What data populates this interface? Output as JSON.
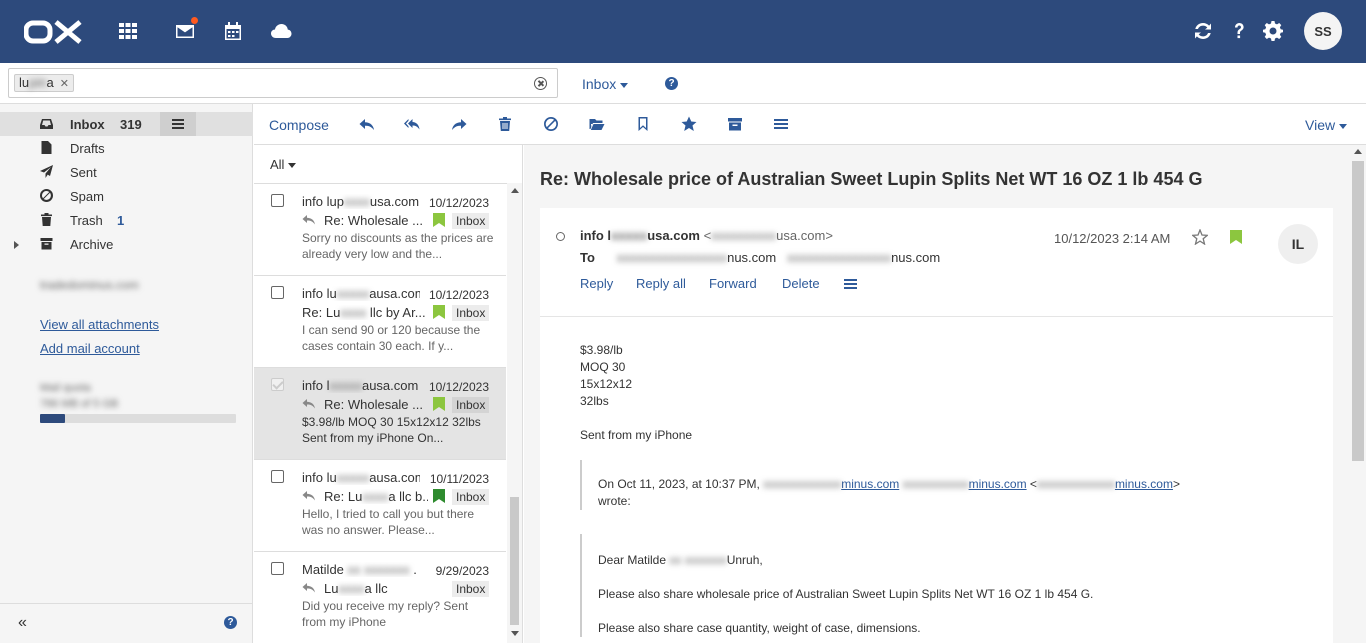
{
  "app": {
    "logo_text": "OX",
    "user_initials": "SS"
  },
  "search": {
    "token_visible": "lu",
    "token_blurred": "pin",
    "token_tail": "a",
    "folder_select": "Inbox"
  },
  "sidebar": {
    "folders": [
      {
        "label": "Inbox",
        "count": "319"
      },
      {
        "label": "Drafts",
        "count": ""
      },
      {
        "label": "Sent",
        "count": ""
      },
      {
        "label": "Spam",
        "count": ""
      },
      {
        "label": "Trash",
        "count": "1"
      },
      {
        "label": "Archive",
        "count": ""
      }
    ],
    "account_name": "tradedominus.com",
    "view_attachments": "View all attachments",
    "add_account": "Add mail account",
    "quota_label": "Mail quota",
    "quota_value": "786 MB of 5 GB",
    "quota_fraction": 0.13
  },
  "toolbar": {
    "compose": "Compose",
    "view": "View"
  },
  "list": {
    "filter": "All",
    "items": [
      {
        "from_a": "info lup",
        "from_b": "xxxx",
        "from_c": "usa.com",
        "date": "10/12/2023",
        "subject": "Re: Wholesale ...",
        "folder": "Inbox",
        "preview": "Sorry no discounts as the prices are already very low and the..."
      },
      {
        "from_a": "info lu",
        "from_b": "xxxxx",
        "from_c": "ausa.com",
        "date": "10/12/2023",
        "subject": "Re: Lu",
        "subject_b": "xxxx",
        "subject_c": " llc by Ar...",
        "folder": "Inbox",
        "preview": "I can send 90 or 120 because the cases contain 30 each. If y..."
      },
      {
        "from_a": "info l",
        "from_b": "xxxxx",
        "from_c": "ausa.com",
        "date": "10/12/2023",
        "subject": "Re: Wholesale ...",
        "folder": "Inbox",
        "preview": "$3.98/lb MOQ 30 15x12x12 32lbs Sent from my iPhone On..."
      },
      {
        "from_a": "info lu",
        "from_b": "xxxxx",
        "from_c": "ausa.com",
        "date": "10/11/2023",
        "subject": "Re: Lu",
        "subject_b": "xxxx",
        "subject_c": "a llc b...",
        "folder": "Inbox",
        "preview": "Hello, I tried to call you but there was no answer. Please..."
      },
      {
        "from_a": "Matilde ",
        "from_b": "xx xxxxxxx",
        "from_c": " .",
        "date": "9/29/2023",
        "subject": "Lu",
        "subject_b": "xxxx",
        "subject_c": "a llc",
        "folder": "Inbox",
        "preview": "Did you receive my reply? Sent from my iPhone"
      }
    ]
  },
  "detail": {
    "subject": "Re: Wholesale price of Australian Sweet Lupin Splits Net WT 16 OZ 1 lb 454 G",
    "from_a": "info l",
    "from_b": "xxxxx",
    "from_c": "usa.com",
    "from_addr_b": "xxxxxxxxxx",
    "from_addr_c": "usa.com",
    "to_label": "To",
    "to_b1": "xxxxxxxxxxxxxxxxx",
    "to_c1": "nus.com",
    "to_b2": "xxxxxxxxxxxxxxxx",
    "to_c2": "nus.com",
    "date": "10/12/2023 2:14 AM",
    "sender_initials": "IL",
    "actions": {
      "reply": "Reply",
      "reply_all": "Reply all",
      "forward": "Forward",
      "delete": "Delete"
    },
    "body_lines": [
      "$3.98/lb",
      "MOQ 30",
      "15x12x12",
      "32lbs"
    ],
    "signature": "Sent from my iPhone",
    "quote_intro": "On Oct 11, 2023, at 10:37 PM,",
    "quote_link_c": "minus.com",
    "quote_wrote": "wrote:",
    "quote_greeting_a": "Dear Matilde ",
    "quote_greeting_b": "xx xxxxxxx",
    "quote_greeting_c": "Unruh,",
    "quote_p1": "Please also share wholesale price of Australian Sweet Lupin Splits Net WT 16 OZ 1 lb 454 G.",
    "quote_p2": "Please also share case quantity, weight of case, dimensions."
  },
  "colors": {
    "topbar": "#2d4a7c",
    "accent": "#2e5a9a",
    "flag_light": "#8cc63f",
    "flag_dark": "#2e8b2e"
  }
}
